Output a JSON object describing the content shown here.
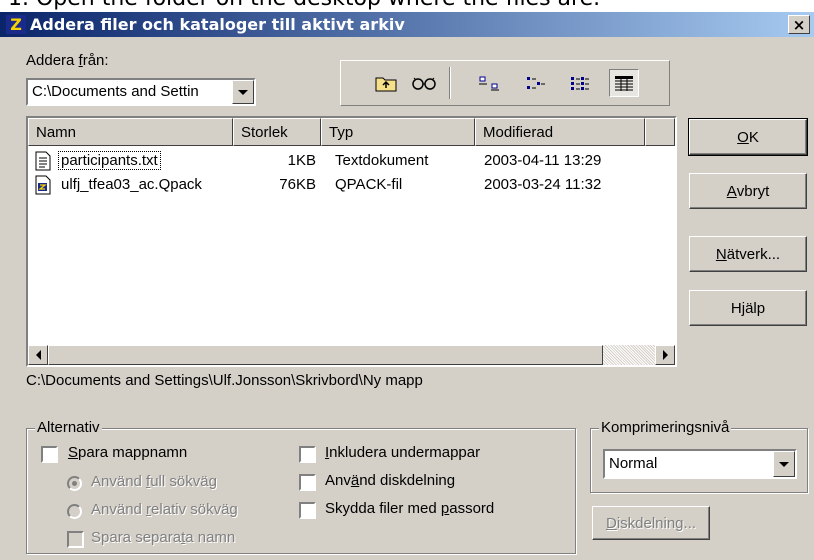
{
  "caption": "1. Open the folder on the desktop where the files are.",
  "window": {
    "title": "Addera filer och kataloger till aktivt arkiv",
    "close_symbol": "×"
  },
  "add_from": {
    "label_pre": "Addera ",
    "label_mnemonic": "f",
    "label_post": "rån:",
    "value": "C:\\Documents and Settin"
  },
  "toolbar": {
    "icons": [
      "folder-up-icon",
      "find-icon",
      "large-icons-view-icon",
      "small-icons-view-icon",
      "list-view-icon",
      "details-view-icon"
    ],
    "selected_view": "details"
  },
  "file_list": {
    "columns": [
      "Namn",
      "Storlek",
      "Typ",
      "Modifierad"
    ],
    "rows": [
      {
        "name": "participants.txt",
        "size": "1KB",
        "type": "Textdokument",
        "modified": "2003-04-11 13:29",
        "icon": "text-file-icon"
      },
      {
        "name": "ulfj_tfea03_ac.Qpack",
        "size": "76KB",
        "type": "QPACK-fil",
        "modified": "2003-03-24 11:32",
        "icon": "qpack-file-icon"
      }
    ]
  },
  "current_path": "C:\\Documents and Settings\\Ulf.Jonsson\\Skrivbord\\Ny mapp",
  "buttons": {
    "ok": {
      "mnemonic": "O",
      "rest": "K"
    },
    "cancel": {
      "mnemonic": "A",
      "rest": "vbryt"
    },
    "network": {
      "mnemonic": "N",
      "rest": "ätverk..."
    },
    "help": {
      "pre": "H",
      "mnemonic": "j",
      "rest": "älp"
    }
  },
  "options": {
    "title": "Alternativ",
    "save_folder_names": {
      "mnemonic": "S",
      "rest": "para mappnamn",
      "checked": false
    },
    "use_full_path": {
      "pre": "Använd ",
      "mnemonic": "f",
      "rest": "ull sökväg",
      "selected": true,
      "enabled": false
    },
    "use_relative_path": {
      "pre": "Använd ",
      "mnemonic": "r",
      "rest": "elativ sökväg",
      "selected": false,
      "enabled": false
    },
    "save_separate_names": {
      "pre": "Spara separa",
      "mnemonic": "t",
      "rest": "a namn",
      "checked": false,
      "enabled": false
    },
    "include_subfolders": {
      "mnemonic": "I",
      "rest": "nkludera undermappar",
      "checked": false
    },
    "use_disk_spanning": {
      "pre": "Anv",
      "mnemonic": "ä",
      "rest": "nd diskdelning",
      "checked": false
    },
    "protect_with_password": {
      "pre": "Skydda filer med ",
      "mnemonic": "p",
      "rest": "assord",
      "checked": false
    }
  },
  "compression": {
    "title": "Komprimeringsnivå",
    "value": "Normal",
    "disk_spanning_button": {
      "mnemonic": "D",
      "rest": "iskdelning..."
    }
  }
}
